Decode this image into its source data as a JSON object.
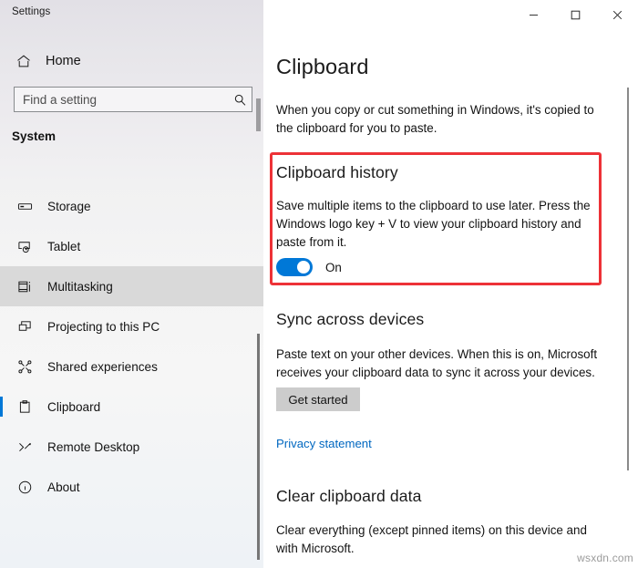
{
  "window": {
    "app_title": "Settings",
    "controls": [
      {
        "name": "minimize",
        "glyph": "–"
      },
      {
        "name": "maximize",
        "glyph": "□"
      },
      {
        "name": "close",
        "glyph": "✕"
      }
    ]
  },
  "sidebar": {
    "home_label": "Home",
    "home_icon": "home-icon",
    "search": {
      "placeholder": "Find a setting",
      "value": "",
      "icon": "search-icon"
    },
    "section_label": "System",
    "items": [
      {
        "label": "Storage",
        "icon": "storage-icon",
        "state": "normal"
      },
      {
        "label": "Tablet",
        "icon": "tablet-icon",
        "state": "normal"
      },
      {
        "label": "Multitasking",
        "icon": "multitasking-icon",
        "state": "hovered"
      },
      {
        "label": "Projecting to this PC",
        "icon": "projecting-icon",
        "state": "normal"
      },
      {
        "label": "Shared experiences",
        "icon": "shared-icon",
        "state": "normal"
      },
      {
        "label": "Clipboard",
        "icon": "clipboard-icon",
        "state": "selected"
      },
      {
        "label": "Remote Desktop",
        "icon": "remote-desktop-icon",
        "state": "normal"
      },
      {
        "label": "About",
        "icon": "info-icon",
        "state": "normal"
      }
    ]
  },
  "main": {
    "page_title": "Clipboard",
    "intro": "When you copy or cut something in Windows, it's copied to the clipboard for you to paste.",
    "clipboard_history": {
      "heading": "Clipboard history",
      "body": "Save multiple items to the clipboard to use later. Press the Windows logo key + V to view your clipboard history and paste from it.",
      "toggle_state": "On",
      "toggle_on": true
    },
    "sync_across_devices": {
      "heading": "Sync across devices",
      "body": "Paste text on your other devices. When this is on, Microsoft receives your clipboard data to sync it across your devices.",
      "button_label": "Get started",
      "privacy_link": "Privacy statement"
    },
    "clear_clipboard_data": {
      "heading": "Clear clipboard data",
      "body": "Clear everything (except pinned items) on this device and with Microsoft."
    }
  },
  "colors": {
    "accent": "#0078d7",
    "highlight_border": "#ed3237",
    "link": "#0067c0",
    "button_bg": "#cccccc"
  },
  "watermark": "wsxdn.com"
}
